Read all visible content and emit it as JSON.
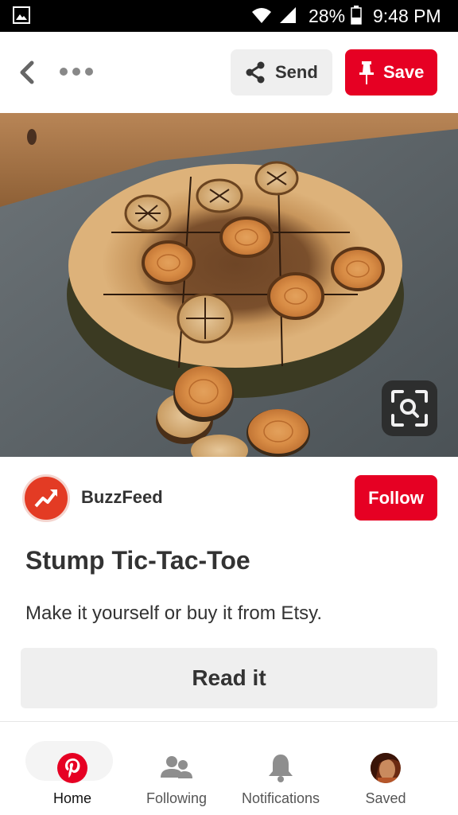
{
  "status_bar": {
    "battery": "28%",
    "time": "9:48 PM",
    "icons": [
      "gallery-icon",
      "wifi-icon",
      "signal-icon",
      "battery-icon"
    ]
  },
  "top_bar": {
    "back_icon": "back-chevron-icon",
    "more_icon": "more-dots-icon",
    "send_label": "Send",
    "save_label": "Save"
  },
  "pin": {
    "image_alt": "Wooden stump tic-tac-toe board with wood slice pieces",
    "visual_search_icon": "visual-search-icon"
  },
  "creator": {
    "name": "BuzzFeed",
    "follow_label": "Follow"
  },
  "details": {
    "title": "Stump Tic-Tac-Toe",
    "description": "Make it yourself or buy it from Etsy.",
    "read_label": "Read it"
  },
  "bottom_nav": {
    "items": [
      {
        "label": "Home",
        "icon": "pinterest-logo-icon",
        "active": true
      },
      {
        "label": "Following",
        "icon": "people-icon",
        "active": false
      },
      {
        "label": "Notifications",
        "icon": "bell-icon",
        "active": false
      },
      {
        "label": "Saved",
        "icon": "profile-avatar",
        "active": false
      }
    ]
  },
  "colors": {
    "brand_red": "#e60023",
    "button_gray": "#efefef",
    "status_bar": "#000000"
  }
}
